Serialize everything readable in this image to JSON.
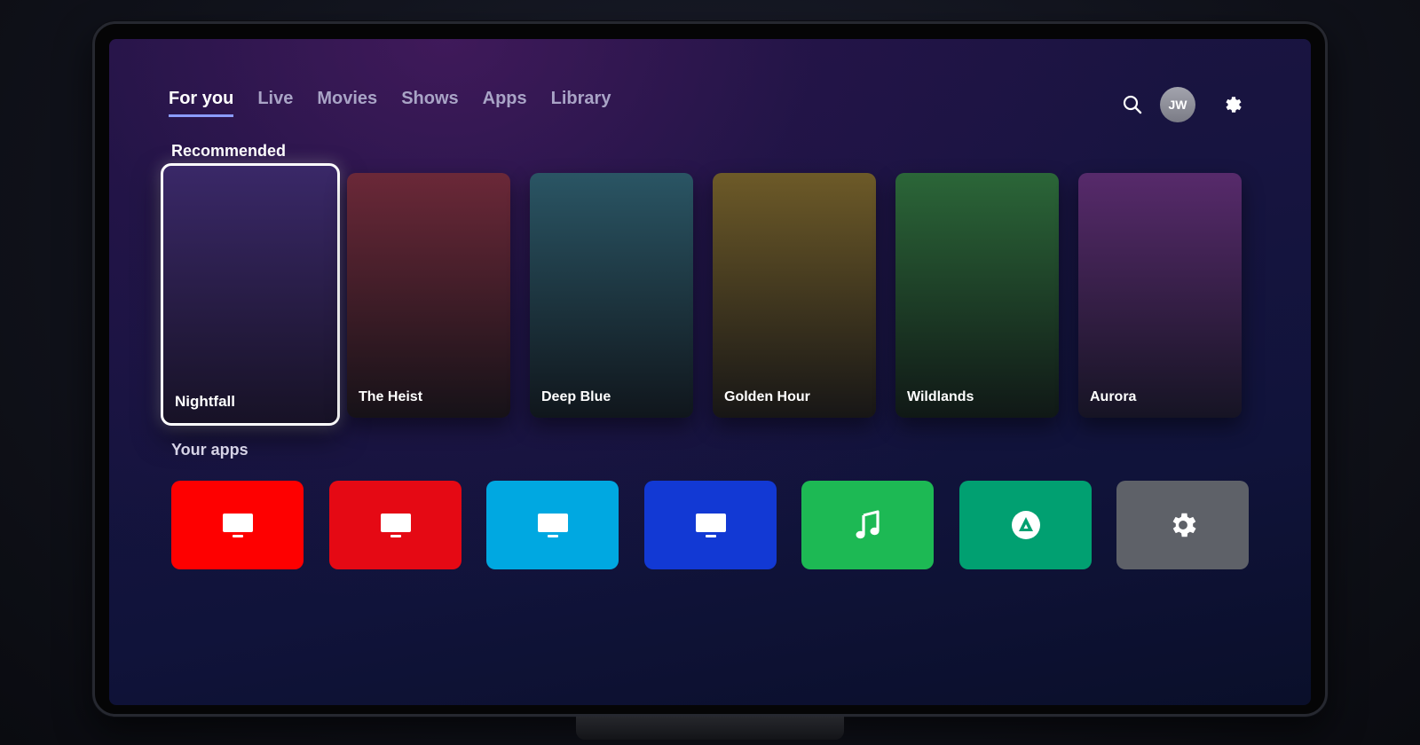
{
  "nav": {
    "tabs": [
      {
        "label": "For you",
        "active": true
      },
      {
        "label": "Live",
        "active": false
      },
      {
        "label": "Movies",
        "active": false
      },
      {
        "label": "Shows",
        "active": false
      },
      {
        "label": "Apps",
        "active": false
      },
      {
        "label": "Library",
        "active": false
      }
    ]
  },
  "header": {
    "search_icon": "search-icon",
    "avatar_initials": "JW",
    "settings_icon": "gear-icon"
  },
  "recommended": {
    "title": "Recommended",
    "items": [
      {
        "title": "Nightfall",
        "focused": true,
        "color_top": "#3a2868",
        "color_bottom": "#171226"
      },
      {
        "title": "The Heist",
        "focused": false,
        "color_top": "#6b2838",
        "color_bottom": "#161218"
      },
      {
        "title": "Deep Blue",
        "focused": false,
        "color_top": "#2a5564",
        "color_bottom": "#10161c"
      },
      {
        "title": "Golden Hour",
        "focused": false,
        "color_top": "#6d5a28",
        "color_bottom": "#171616"
      },
      {
        "title": "Wildlands",
        "focused": false,
        "color_top": "#2b6638",
        "color_bottom": "#101816"
      },
      {
        "title": "Aurora",
        "focused": false,
        "color_top": "#572a6b",
        "color_bottom": "#161424"
      }
    ]
  },
  "apps": {
    "title": "Your apps",
    "items": [
      {
        "icon": "tv-icon",
        "color": "#fe0000"
      },
      {
        "icon": "tv-icon",
        "color": "#e50914"
      },
      {
        "icon": "tv-icon",
        "color": "#00a8e1"
      },
      {
        "icon": "tv-icon",
        "color": "#1239d4"
      },
      {
        "icon": "music-note-icon",
        "color": "#1db954"
      },
      {
        "icon": "store-icon",
        "color": "#01a071"
      },
      {
        "icon": "gear-icon",
        "color": "#5e6168"
      }
    ]
  }
}
